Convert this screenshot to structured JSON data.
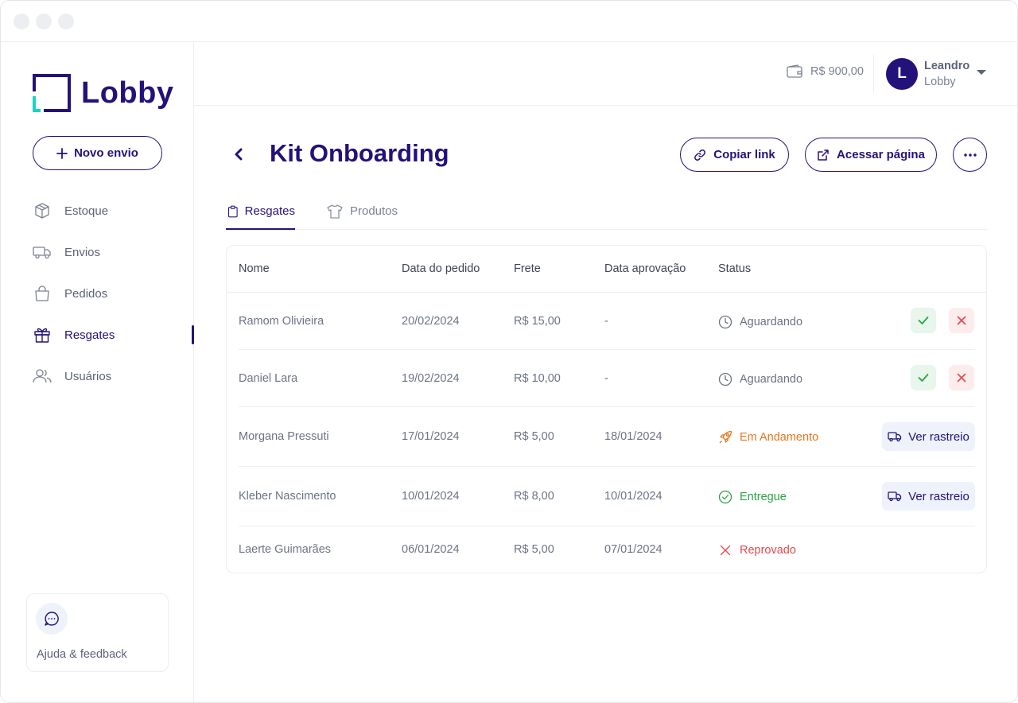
{
  "brand": {
    "name": "Lobby"
  },
  "sidebar": {
    "new_button": "Novo envio",
    "items": [
      {
        "label": "Estoque",
        "icon": "box-icon",
        "active": false
      },
      {
        "label": "Envios",
        "icon": "truck-icon",
        "active": false
      },
      {
        "label": "Pedidos",
        "icon": "shopping-bag-icon",
        "active": false
      },
      {
        "label": "Resgates",
        "icon": "gift-icon",
        "active": true
      },
      {
        "label": "Usuários",
        "icon": "users-icon",
        "active": false
      }
    ],
    "help_label": "Ajuda & feedback"
  },
  "header": {
    "balance": "R$ 900,00",
    "user": {
      "initial": "L",
      "name": "Leandro",
      "org": "Lobby"
    }
  },
  "page": {
    "title": "Kit Onboarding",
    "copy_link": "Copiar link",
    "access_page": "Acessar página",
    "tabs": [
      {
        "label": "Resgates",
        "active": true
      },
      {
        "label": "Produtos",
        "active": false
      }
    ]
  },
  "table": {
    "columns": [
      "Nome",
      "Data do pedido",
      "Frete",
      "Data aprovação",
      "Status"
    ],
    "rows": [
      {
        "name": "Ramom Olivieira",
        "order_date": "20/02/2024",
        "shipping": "R$ 15,00",
        "approval_date": "-",
        "status": "Aguardando",
        "status_type": "waiting"
      },
      {
        "name": "Daniel Lara",
        "order_date": "19/02/2024",
        "shipping": "R$ 10,00",
        "approval_date": "-",
        "status": "Aguardando",
        "status_type": "waiting"
      },
      {
        "name": "Morgana Pressuti",
        "order_date": "17/01/2024",
        "shipping": "R$ 5,00",
        "approval_date": "18/01/2024",
        "status": "Em Andamento",
        "status_type": "progress",
        "action": "Ver rastreio"
      },
      {
        "name": "Kleber Nascimento",
        "order_date": "10/01/2024",
        "shipping": "R$ 8,00",
        "approval_date": "10/01/2024",
        "status": "Entregue",
        "status_type": "delivered",
        "action": "Ver rastreio"
      },
      {
        "name": "Laerte Guimarães",
        "order_date": "06/01/2024",
        "shipping": "R$ 5,00",
        "approval_date": "07/01/2024",
        "status": "Reprovado",
        "status_type": "rejected"
      }
    ]
  },
  "colors": {
    "primary": "#23127a",
    "accent": "#19d3c5",
    "progress": "#e8751a",
    "success": "#2aa344",
    "danger": "#e5484d"
  }
}
